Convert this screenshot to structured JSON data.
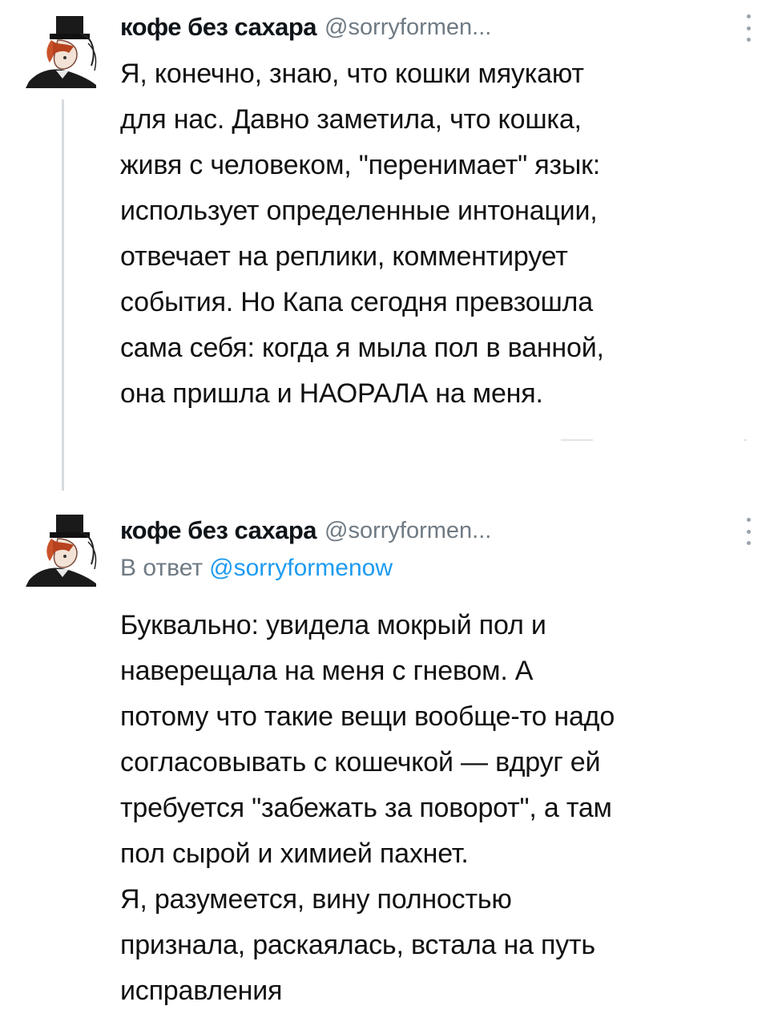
{
  "tweets": [
    {
      "display_name": "кофе без сахара",
      "handle": "@sorryformen...",
      "avatar_icon": "character-avatar-icon",
      "more_icon": "more-vertical-icon",
      "lines": [
        "Я, конечно, знаю, что кошки мяукают",
        "для нас. Давно заметила, что кошка,",
        "живя с человеком, \"перенимает\" язык:",
        "использует определенные интонации,",
        "отвечает на реплики, комментирует",
        "события. Но Капа сегодня превзошла",
        "сама себя: когда я мыла пол в ванной,",
        "она пришла и НАОРАЛА на меня."
      ]
    },
    {
      "display_name": "кофе без сахара",
      "handle": "@sorryformen...",
      "avatar_icon": "character-avatar-icon",
      "more_icon": "more-vertical-icon",
      "reply_prefix": "В ответ",
      "reply_mention": "@sorryformenow",
      "lines": [
        "Буквально: увидела мокрый пол и",
        "наверещала на меня с гневом. А",
        "потому что такие вещи вообще-то надо",
        "согласовывать с кошечкой — вдруг ей",
        "требуется \"забежать за поворот\", а там",
        "пол сырой и химией пахнет.",
        "Я, разумеется, вину полностью",
        "признала, раскаялась, встала на путь",
        "исправления"
      ]
    }
  ],
  "colors": {
    "text": "#111111",
    "secondary": "#6f7a83",
    "link": "#1d9bf0",
    "thread_line": "#d7dbdf"
  }
}
